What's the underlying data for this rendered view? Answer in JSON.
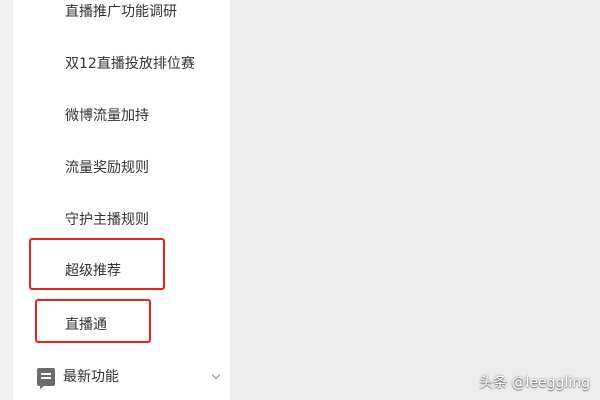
{
  "sidebar": {
    "items": [
      {
        "label": "直播推广功能调研"
      },
      {
        "label": "双12直播投放排位赛"
      },
      {
        "label": "微博流量加持"
      },
      {
        "label": "流量奖励规则"
      },
      {
        "label": "守护主播规则"
      },
      {
        "label": "超级推荐",
        "highlighted": true
      },
      {
        "label": "直播通",
        "highlighted": true
      }
    ],
    "section": {
      "label": "最新功能",
      "icon": "message-icon",
      "chevron": "chevron-down-icon"
    }
  },
  "highlight_color": "#e8221c",
  "watermark": "头条 @leeggling"
}
